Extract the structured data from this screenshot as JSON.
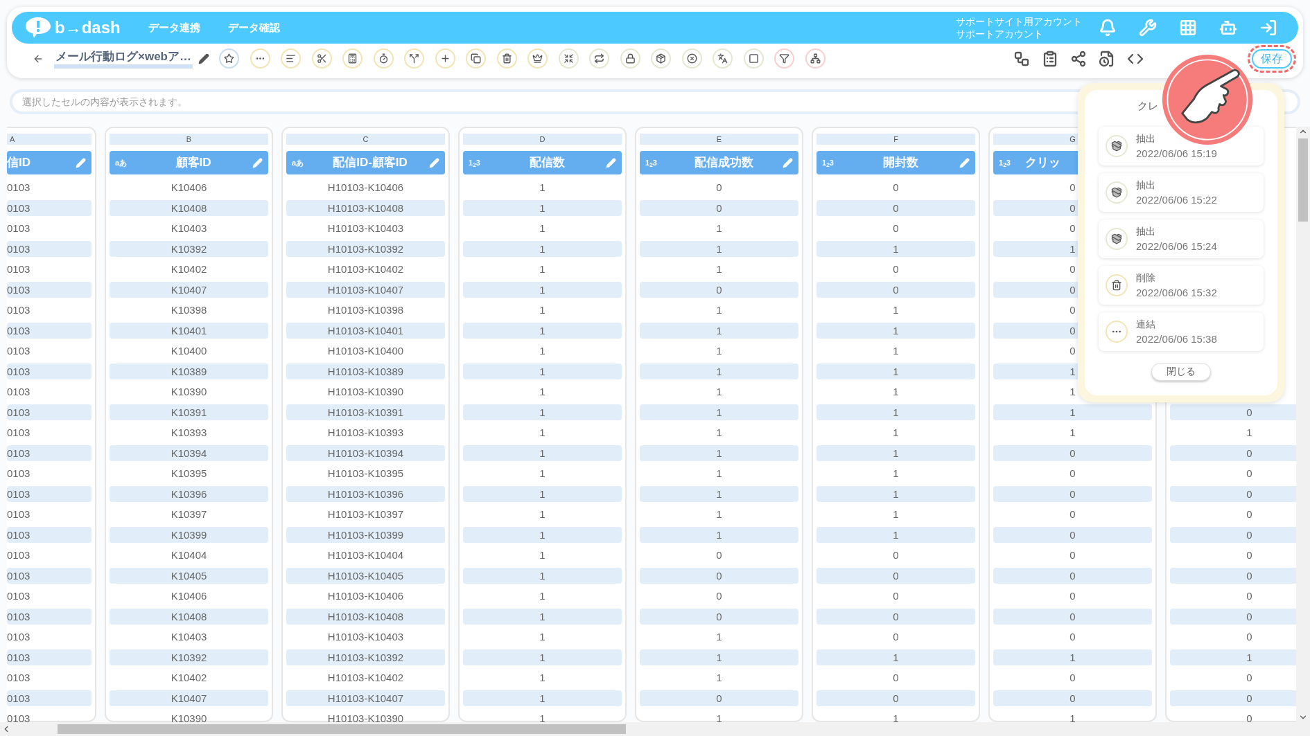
{
  "header": {
    "logo": "b→dash",
    "nav": [
      "データ連携",
      "データ確認"
    ],
    "account": [
      "サポートサイト用アカウント",
      "サポートアカウント"
    ]
  },
  "toolbar": {
    "title": "メール行動ログ×webア…",
    "save": "保存"
  },
  "cell_bar": {
    "placeholder": "選択したセルの内容が表示されます。"
  },
  "columns": [
    {
      "letter": "A",
      "name": "信ID"
    },
    {
      "letter": "B",
      "type": "aあ",
      "name": "顧客ID"
    },
    {
      "letter": "C",
      "type": "aあ",
      "name": "配信ID-顧客ID"
    },
    {
      "letter": "D",
      "type": "1$_{2}$3",
      "name": "配信数"
    },
    {
      "letter": "E",
      "type": "1$_{2}$3",
      "name": "配信成功数"
    },
    {
      "letter": "F",
      "type": "1$_{2}$3",
      "name": "開封数"
    },
    {
      "letter": "G",
      "type": "1$_{2}$3",
      "name": "クリッ"
    }
  ],
  "rows": [
    [
      "0103",
      "K10406",
      "H10103-K10406",
      "1",
      "0",
      "0",
      "0"
    ],
    [
      "0103",
      "K10408",
      "H10103-K10408",
      "1",
      "0",
      "0",
      "0"
    ],
    [
      "0103",
      "K10403",
      "H10103-K10403",
      "1",
      "1",
      "0",
      "0"
    ],
    [
      "0103",
      "K10392",
      "H10103-K10392",
      "1",
      "1",
      "1",
      "1"
    ],
    [
      "0103",
      "K10402",
      "H10103-K10402",
      "1",
      "1",
      "0",
      "0"
    ],
    [
      "0103",
      "K10407",
      "H10103-K10407",
      "1",
      "0",
      "0",
      "0"
    ],
    [
      "0103",
      "K10398",
      "H10103-K10398",
      "1",
      "1",
      "1",
      "0"
    ],
    [
      "0103",
      "K10401",
      "H10103-K10401",
      "1",
      "1",
      "1",
      "0"
    ],
    [
      "0103",
      "K10400",
      "H10103-K10400",
      "1",
      "1",
      "1",
      "0"
    ],
    [
      "0103",
      "K10389",
      "H10103-K10389",
      "1",
      "1",
      "1",
      "1"
    ],
    [
      "0103",
      "K10390",
      "H10103-K10390",
      "1",
      "1",
      "1",
      "1"
    ],
    [
      "0103",
      "K10391",
      "H10103-K10391",
      "1",
      "1",
      "1",
      "1",
      "0"
    ],
    [
      "0103",
      "K10393",
      "H10103-K10393",
      "1",
      "1",
      "1",
      "1",
      "1"
    ],
    [
      "0103",
      "K10394",
      "H10103-K10394",
      "1",
      "1",
      "1",
      "0",
      "0"
    ],
    [
      "0103",
      "K10395",
      "H10103-K10395",
      "1",
      "1",
      "1",
      "0",
      "0"
    ],
    [
      "0103",
      "K10396",
      "H10103-K10396",
      "1",
      "1",
      "1",
      "0",
      "0"
    ],
    [
      "0103",
      "K10397",
      "H10103-K10397",
      "1",
      "1",
      "1",
      "0",
      "0"
    ],
    [
      "0103",
      "K10399",
      "H10103-K10399",
      "1",
      "1",
      "1",
      "0",
      "0"
    ],
    [
      "0103",
      "K10404",
      "H10103-K10404",
      "1",
      "0",
      "0",
      "0",
      "0"
    ],
    [
      "0103",
      "K10405",
      "H10103-K10405",
      "1",
      "0",
      "0",
      "0",
      "0"
    ],
    [
      "0103",
      "K10406",
      "H10103-K10406",
      "1",
      "0",
      "0",
      "0",
      "0"
    ],
    [
      "0103",
      "K10408",
      "H10103-K10408",
      "1",
      "0",
      "0",
      "0",
      "0"
    ],
    [
      "0103",
      "K10403",
      "H10103-K10403",
      "1",
      "1",
      "0",
      "0",
      "0"
    ],
    [
      "0103",
      "K10392",
      "H10103-K10392",
      "1",
      "1",
      "1",
      "1",
      "1"
    ],
    [
      "0103",
      "K10402",
      "H10103-K10402",
      "1",
      "1",
      "0",
      "0",
      "0"
    ],
    [
      "0103",
      "K10407",
      "H10103-K10407",
      "1",
      "0",
      "0",
      "0",
      "0"
    ],
    [
      "0103",
      "K10390",
      "H10103-K10390",
      "1",
      "1",
      "1",
      "1",
      "0"
    ]
  ],
  "history": {
    "title": "クレ",
    "items": [
      {
        "kind": "extract",
        "label": "抽出",
        "time": "2022/06/06 15:19"
      },
      {
        "kind": "extract",
        "label": "抽出",
        "time": "2022/06/06 15:22"
      },
      {
        "kind": "extract",
        "label": "抽出",
        "time": "2022/06/06 15:24"
      },
      {
        "kind": "delete",
        "label": "削除",
        "time": "2022/06/06 15:32"
      },
      {
        "kind": "join",
        "label": "連結",
        "time": "2022/06/06 15:38"
      }
    ],
    "close": "閉じる"
  }
}
